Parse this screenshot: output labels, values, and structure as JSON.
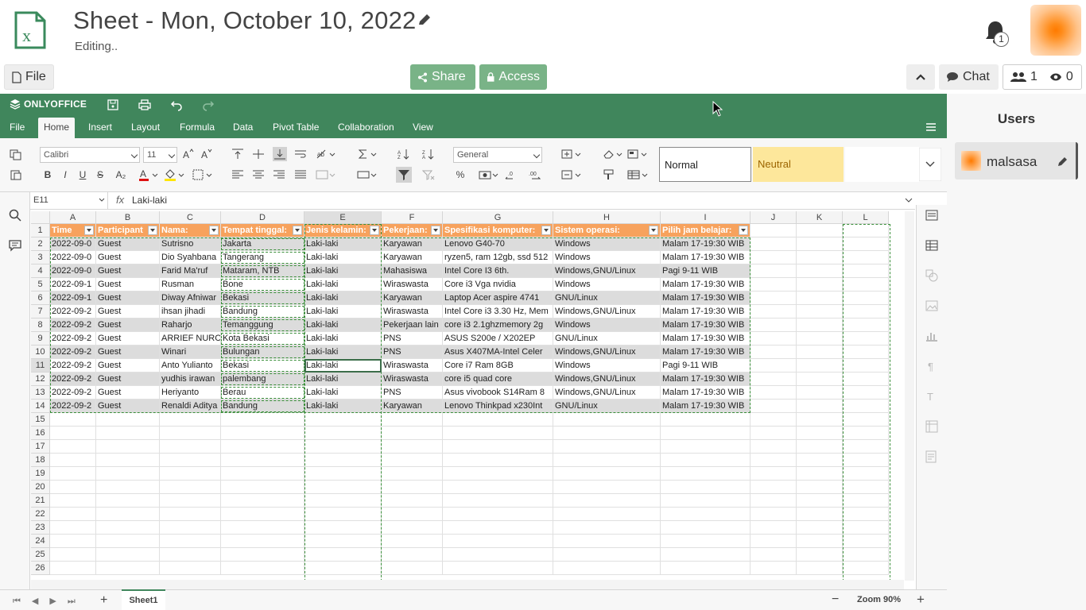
{
  "app": {
    "title": "Sheet - Mon, October 10, 2022",
    "status": "Editing..",
    "notifications": "1"
  },
  "top_buttons": {
    "file": "File",
    "share": "Share",
    "access": "Access",
    "chat": "Chat",
    "users_count": "1",
    "viewers_count": "0"
  },
  "editor": {
    "brand": "ONLYOFFICE",
    "tabs": [
      "File",
      "Home",
      "Insert",
      "Layout",
      "Formula",
      "Data",
      "Pivot Table",
      "Collaboration",
      "View"
    ],
    "active_tab": "Home",
    "font_name": "Calibri",
    "font_size": "11",
    "number_format": "General",
    "styles": [
      "Normal",
      "Neutral"
    ],
    "name_box": "E11",
    "fx": "fx",
    "formula_value": "Laki-laki",
    "sheet_tab": "Sheet1",
    "zoom": "Zoom 90%"
  },
  "colors": {
    "header_green": "#40865c",
    "action_green": "#79b387",
    "table_header": "#f7a25d",
    "band": "#dcdcdc",
    "neutral_fill": "#fde79b"
  },
  "grid": {
    "columns": [
      "A",
      "B",
      "C",
      "D",
      "E",
      "F",
      "G",
      "H",
      "I",
      "J",
      "K",
      "L"
    ],
    "row_numbers": [
      "1",
      "2",
      "3",
      "4",
      "5",
      "6",
      "7",
      "8",
      "9",
      "10",
      "11",
      "12",
      "13",
      "14",
      "15",
      "16",
      "17",
      "18",
      "19",
      "20",
      "21",
      "22",
      "23",
      "24",
      "25",
      "26"
    ],
    "headers": [
      "Time",
      "Participant",
      "Nama:",
      "Tempat tinggal:",
      "Jenis kelamin:",
      "Pekerjaan:",
      "Spesifikasi komputer:",
      "Sistem operasi:",
      "Pilih jam belajar:"
    ],
    "rows": [
      [
        "2022-09-0",
        "Guest",
        "Sutrisno",
        "Jakarta",
        "Laki-laki",
        "Karyawan",
        "Lenovo G40-70",
        "Windows",
        "Malam 17-19:30 WIB"
      ],
      [
        "2022-09-0",
        "Guest",
        "Dio Syahbana",
        "Tangerang",
        "Laki-laki",
        "Karyawan",
        "ryzen5, ram 12gb, ssd 512",
        "Windows",
        "Malam 17-19:30 WIB"
      ],
      [
        "2022-09-0",
        "Guest",
        "Farid Ma'ruf",
        "Mataram, NTB",
        "Laki-laki",
        "Mahasiswa",
        "Intel Core I3 6th.",
        "Windows,GNU/Linux",
        "Pagi 9-11 WIB"
      ],
      [
        "2022-09-1",
        "Guest",
        "Rusman",
        "Bone",
        "Laki-laki",
        "Wiraswasta",
        "Core i3 Vga nvidia",
        "Windows",
        "Malam 17-19:30 WIB"
      ],
      [
        "2022-09-1",
        "Guest",
        "Diway Afniwar",
        "Bekasi",
        "Laki-laki",
        "Karyawan",
        "Laptop Acer aspire 4741",
        "GNU/Linux",
        "Malam 17-19:30 WIB"
      ],
      [
        "2022-09-2",
        "Guest",
        "ihsan jihadi",
        "Bandung",
        "Laki-laki",
        "Wiraswasta",
        "Intel Core i3 3.30 Hz, Mem",
        "Windows,GNU/Linux",
        "Malam 17-19:30 WIB"
      ],
      [
        "2022-09-2",
        "Guest",
        "Raharjo",
        "Temanggung",
        "Laki-laki",
        "Pekerjaan lain",
        "core i3 2.1ghzmemory 2g",
        "Windows",
        "Malam 17-19:30 WIB"
      ],
      [
        "2022-09-2",
        "Guest",
        "ARRIEF NURCA",
        "Kota Bekasi",
        "Laki-laki",
        "PNS",
        "ASUS S200e / X202EP",
        "GNU/Linux",
        "Malam 17-19:30 WIB"
      ],
      [
        "2022-09-2",
        "Guest",
        "Winari",
        "Bulungan",
        "Laki-laki",
        "PNS",
        "Asus X407MA-Intel Celer",
        "Windows,GNU/Linux",
        "Malam 17-19:30 WIB"
      ],
      [
        "2022-09-2",
        "Guest",
        "Anto Yulianto",
        "Bekasi",
        "Laki-laki",
        "Wiraswasta",
        "Core i7 Ram 8GB",
        "Windows",
        "Pagi 9-11 WIB"
      ],
      [
        "2022-09-2",
        "Guest",
        "yudhis irawan",
        "palembang",
        "Laki-laki",
        "Wiraswasta",
        "core i5 quad core",
        "Windows,GNU/Linux",
        "Malam 17-19:30 WIB"
      ],
      [
        "2022-09-2",
        "Guest",
        "Heriyanto",
        "Berau",
        "Laki-laki",
        "PNS",
        "Asus vivobook S14Ram 8",
        "Windows,GNU/Linux",
        "Malam 17-19:30 WIB"
      ],
      [
        "2022-09-2",
        "Guest",
        "Renaldi Aditya",
        "Bandung",
        "Laki-laki",
        "Karyawan",
        "Lenovo Thinkpad x230Int",
        "GNU/Linux",
        "Malam 17-19:30 WIB"
      ]
    ]
  },
  "users_panel": {
    "title": "Users",
    "user_name": "malsasa"
  }
}
